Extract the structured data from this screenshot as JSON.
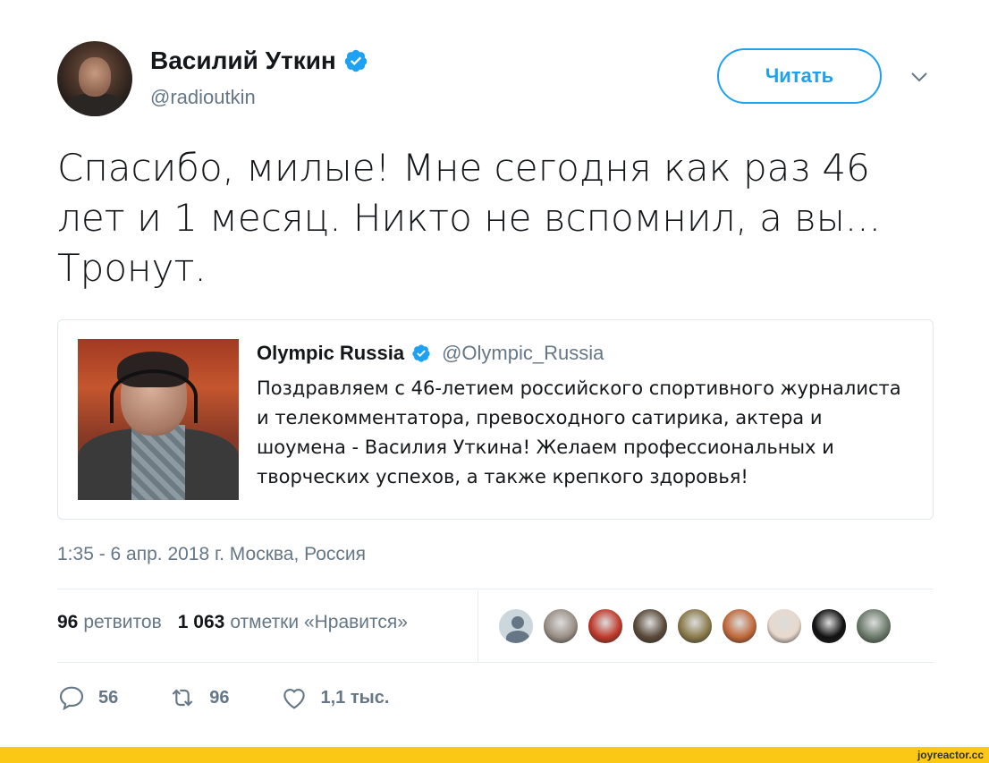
{
  "author": {
    "name": "Василий Уткин",
    "handle": "@radioutkin",
    "verified": true
  },
  "follow_button": {
    "label": "Читать"
  },
  "tweet": {
    "text_lines": [
      "Спасибо, милые! Мне сегодня как раз 46",
      "лет и 1 месяц. Никто не вспомнил, а вы...",
      "Тронут."
    ]
  },
  "quoted_tweet": {
    "name": "Olympic Russia",
    "handle": "@Olympic_Russia",
    "verified": true,
    "text_lines": [
      "Поздравляем с 46-летием российского спортивного журналиста",
      "и телекомментатора, превосходного сатирика, актера и",
      "шоумена - Василия Уткина! Желаем профессиональных и",
      "творческих успехов, а также крепкого здоровья!"
    ]
  },
  "meta": {
    "time_date": "1:35 - 6 апр. 2018 г.",
    "location": "Москва, Россия"
  },
  "stats": {
    "retweets_count": "96",
    "retweets_label": "ретвитов",
    "likes_count": "1 063",
    "likes_label": "отметки «Нравится»"
  },
  "likers": [
    {
      "kind": "default",
      "color": "#ccd6dd"
    },
    {
      "kind": "photo",
      "color": "#9a8f86"
    },
    {
      "kind": "photo",
      "color": "#c0392b"
    },
    {
      "kind": "photo",
      "color": "#5a4a3a"
    },
    {
      "kind": "photo",
      "color": "#8a7a4a"
    },
    {
      "kind": "photo",
      "color": "#c0683a"
    },
    {
      "kind": "photo",
      "color": "#e8d8cc"
    },
    {
      "kind": "photo",
      "color": "#111111"
    },
    {
      "kind": "photo",
      "color": "#6a7a6a"
    }
  ],
  "actions": {
    "reply_count": "56",
    "retweet_count": "96",
    "like_count": "1,1 тыс."
  },
  "watermark": {
    "text": "joyreactor.cc"
  },
  "colors": {
    "accent": "#1da1f2",
    "muted": "#657786",
    "footer": "#fcc816"
  }
}
